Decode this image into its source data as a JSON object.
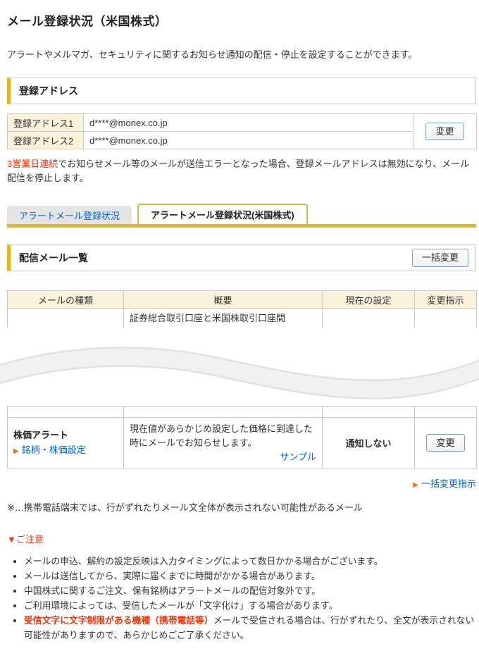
{
  "colors": {
    "accent_gold": "#d2b755",
    "section_gold": "#e2b719",
    "header_cream": "#faf3d9",
    "link_blue": "#0066cc",
    "alert_red": "#e8380d",
    "arrow_orange": "#e87511",
    "button_border": "#7b9ebd"
  },
  "page": {
    "title": "メール登録状況（米国株式）",
    "description": "アラートやメルマガ、セキュリティに関するお知らせ通知の配信・停止を設定することができます。"
  },
  "registered_address": {
    "section_title": "登録アドレス",
    "rows": [
      {
        "label": "登録アドレス1",
        "value": "d****@monex.co.jp"
      },
      {
        "label": "登録アドレス2",
        "value": "d****@monex.co.jp"
      }
    ],
    "change_button": "変更",
    "warning_red": "3営業日連続",
    "warning_rest": "でお知らせメール等のメールが送信エラーとなった場合、登録メールアドレスは無効になり、メール配信を停止します。"
  },
  "tabs": [
    {
      "label": "アラートメール登録状況",
      "active": false
    },
    {
      "label": "アラートメール登録状況(米国株式)",
      "active": true
    }
  ],
  "mail_list": {
    "section_title": "配信メール一覧",
    "bulk_change_button": "一括変更",
    "columns": [
      "メールの種類",
      "概要",
      "現在の設定",
      "変更指示"
    ],
    "truncated_row_summary": "証券総合取引口座と米国株取引口座間",
    "row": {
      "type": "株価アラート",
      "type_link": "銘柄・株価設定",
      "summary": "現在値があらかじめ設定した価格に到達した時にメールでお知らせします。",
      "sample_link": "サンプル",
      "current_setting": "通知しない",
      "change_button": "変更"
    },
    "bulk_change_link": "一括変更指示",
    "arrow_glyph": "▶"
  },
  "footnote": "※…携帯電話端末では、行がずれたりメール文全体が表示されない可能性があるメール",
  "caution": {
    "title": "▼ご注意",
    "items": [
      "メールの申込、解約の設定反映は入力タイミングによって数日かかる場合がございます。",
      "メールは送信してから、実際に届くまでに時間がかかる場合があります。",
      "中国株式に関するご注文、保有銘柄はアラートメールの配信対象外です。",
      "ご利用環境によっては、受信したメールが「文字化け」する場合があります。"
    ],
    "item5_red": "受信文字に文字制限がある機種（携帯電話等）",
    "item5_rest": "メールで受信される場合は、行がずれたり、全文が表示されない可能性がありますので、あらかじめごご了承ください。"
  }
}
